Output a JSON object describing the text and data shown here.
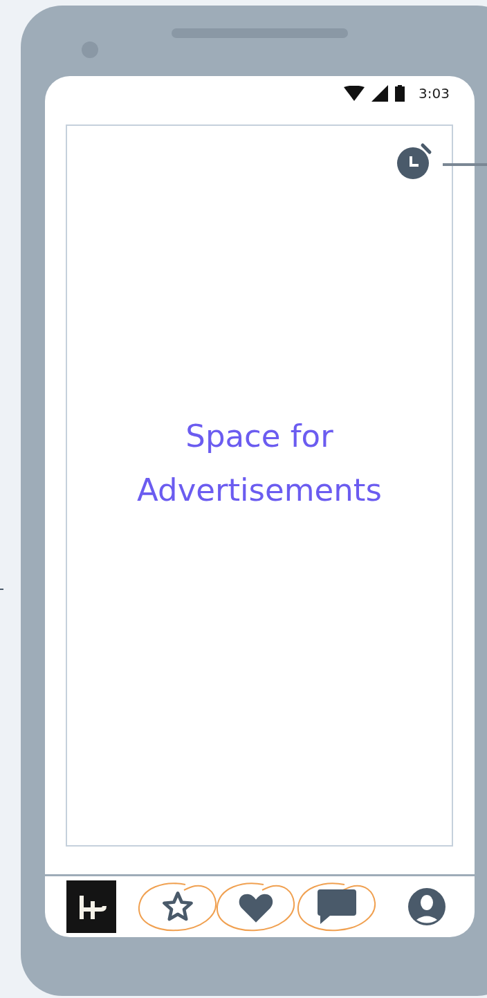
{
  "status_bar": {
    "time": "3:03"
  },
  "ad_space": {
    "text": "Space for Advertisements"
  },
  "bottom_nav": [
    {
      "kind": "logo",
      "highlighted": false
    },
    {
      "kind": "star",
      "highlighted": true
    },
    {
      "kind": "heart",
      "highlighted": true
    },
    {
      "kind": "chat",
      "highlighted": true
    },
    {
      "kind": "profile",
      "highlighted": false
    }
  ]
}
